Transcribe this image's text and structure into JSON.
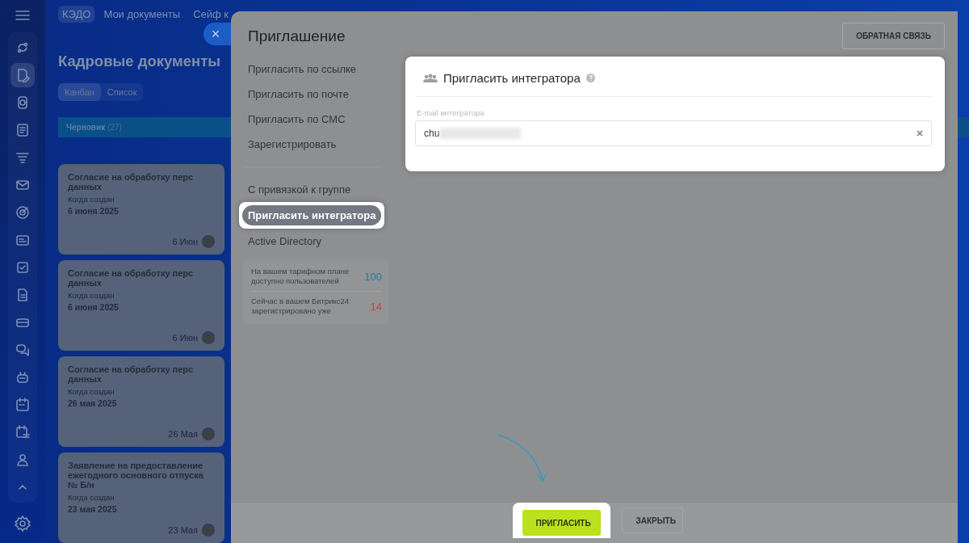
{
  "sidebar": {
    "items": [
      {
        "selected": false
      },
      {
        "selected": true
      },
      {
        "selected": false
      },
      {
        "selected": false
      },
      {
        "selected": false
      },
      {
        "selected": false
      },
      {
        "selected": false
      },
      {
        "selected": false
      },
      {
        "selected": false
      },
      {
        "selected": false
      },
      {
        "selected": false
      },
      {
        "selected": false
      },
      {
        "selected": false
      },
      {
        "selected": false
      },
      {
        "selected": false
      },
      {
        "selected": false
      },
      {
        "selected": false
      }
    ]
  },
  "top_nav": {
    "tabs": [
      {
        "label": "КЭДО",
        "selected": true
      },
      {
        "label": "Мои документы",
        "selected": false
      },
      {
        "label": "Сейф к",
        "selected": false
      }
    ]
  },
  "page": {
    "title": "Кадровые документы",
    "views": [
      {
        "label": "Канбан",
        "selected": true
      },
      {
        "label": "Список",
        "selected": false
      }
    ],
    "column": {
      "name": "Черновик",
      "count": "(27)"
    },
    "cards": [
      {
        "title": "Согласие на обработку перс данных",
        "field_label": "Когда создан",
        "date": "6 июня 2025",
        "short_date": "6 Июн"
      },
      {
        "title": "Согласие на обработку перс данных",
        "field_label": "Когда создан",
        "date": "6 июня 2025",
        "short_date": "6 Июн"
      },
      {
        "title": "Согласие на обработку перс данных",
        "field_label": "Когда создан",
        "date": "26 мая 2025",
        "short_date": "26 Мая"
      },
      {
        "title": "Заявление на предоставление ежегодного основного отпуска № Б/н",
        "field_label": "Когда создан",
        "date": "23 мая 2025",
        "short_date": "23 Мая"
      }
    ]
  },
  "close_button": {
    "label": "×"
  },
  "panel": {
    "title": "Приглашение",
    "feedback_button": "ОБРАТНАЯ СВЯЗЬ",
    "menu": [
      {
        "items": [
          {
            "label": "Пригласить по ссылке",
            "selected": false
          },
          {
            "label": "Пригласить по почте",
            "selected": false
          },
          {
            "label": "Пригласить по СМС",
            "selected": false
          },
          {
            "label": "Зарегистрировать",
            "selected": false
          }
        ]
      },
      {
        "items": [
          {
            "label": "С привязкой к группе",
            "selected": false
          },
          {
            "label": "Пригласить интегратора",
            "selected": true
          },
          {
            "label": "Active Directory",
            "selected": false
          }
        ]
      }
    ],
    "stats": [
      {
        "text": "На вашем тарифном плане доступно пользователей",
        "value": "100",
        "color": "#1b7fa8"
      },
      {
        "text": "Сейчас в вашем Битрикс24 зарегистрировано уже",
        "value": "14",
        "color": "#c0483c"
      }
    ],
    "form": {
      "title": "Пригласить интегратора",
      "field_label": "E-mail интегратора",
      "value": "chu"
    },
    "buttons": [
      {
        "label": "ПРИГЛАСИТЬ",
        "kind": "primary",
        "highlighted": true
      },
      {
        "label": "ЗАКРЫТЬ",
        "kind": "secondary",
        "highlighted": false
      }
    ]
  }
}
